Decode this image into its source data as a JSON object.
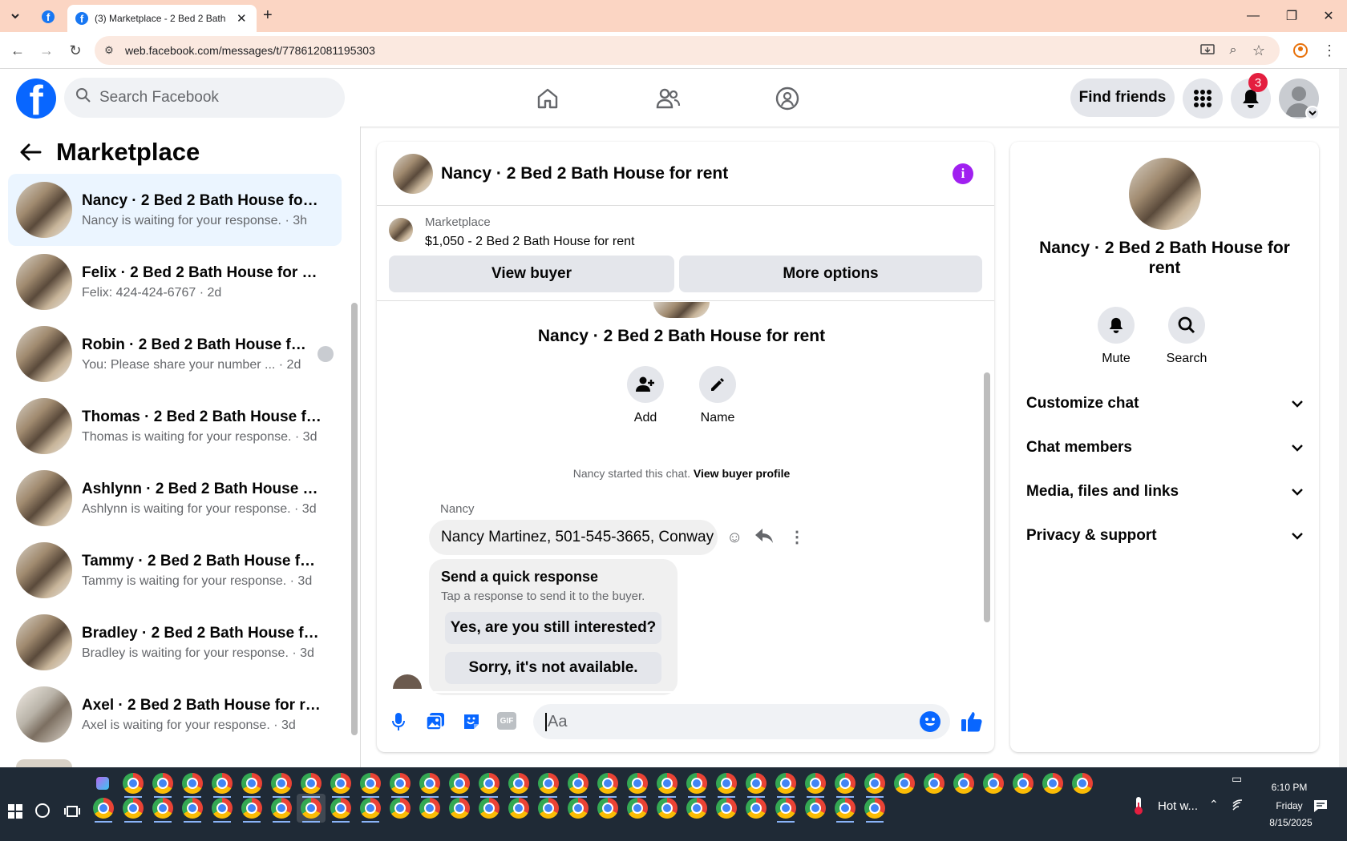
{
  "browser": {
    "tab_title": "(3) Marketplace - 2 Bed 2 Bath",
    "url": "web.facebook.com/messages/t/778612081195303"
  },
  "header": {
    "search_placeholder": "Search Facebook",
    "find_friends": "Find friends",
    "notification_count": "3"
  },
  "sidebar": {
    "title": "Marketplace",
    "conversations": [
      {
        "name": "Nancy · 2 Bed 2 Bath House for r...",
        "preview": "Nancy is waiting for your response.",
        "time": "3h"
      },
      {
        "name": "Felix · 2 Bed 2 Bath House for rent",
        "preview": "Felix: 424-424-6767",
        "time": "2d"
      },
      {
        "name": "Robin · 2 Bed 2 Bath House fo...",
        "preview": "You: Please share your number ...",
        "time": "2d"
      },
      {
        "name": "Thomas · 2 Bed 2 Bath House for...",
        "preview": "Thomas is waiting for your response.",
        "time": "3d"
      },
      {
        "name": "Ashlynn · 2 Bed 2 Bath House for...",
        "preview": "Ashlynn is waiting for your response.",
        "time": "3d"
      },
      {
        "name": "Tammy · 2 Bed 2 Bath House for ...",
        "preview": "Tammy is waiting for your response.",
        "time": "3d"
      },
      {
        "name": "Bradley · 2 Bed 2 Bath House for...",
        "preview": "Bradley is waiting for your response.",
        "time": "3d"
      },
      {
        "name": "Axel · 2 Bed 2 Bath House for rent",
        "preview": "Axel is waiting for your response.",
        "time": "3d"
      }
    ]
  },
  "chat": {
    "title": "Nancy · 2 Bed 2 Bath House for rent",
    "marketplace_label": "Marketplace",
    "listing": "$1,050 - 2 Bed 2 Bath House for rent",
    "view_buyer": "View buyer",
    "more_options": "More options",
    "thread_name": "Nancy · 2 Bed 2 Bath House for rent",
    "add_label": "Add",
    "name_label": "Name",
    "started_text": "Nancy started this chat.",
    "view_buyer_profile": "View buyer profile",
    "sender": "Nancy",
    "message": "Nancy Martinez, 501-545-3665, Conway",
    "quick_title": "Send a quick response",
    "quick_sub": "Tap a response to send it to the buyer.",
    "quick_1": "Yes, are you still interested?",
    "quick_2": "Sorry, it's not available.",
    "composer_placeholder": "Aa"
  },
  "info": {
    "name": "Nancy · 2 Bed 2 Bath House for rent",
    "mute": "Mute",
    "search": "Search",
    "sections": [
      "Customize chat",
      "Chat members",
      "Media, files and links",
      "Privacy & support"
    ]
  },
  "taskbar": {
    "weather": "Hot w...",
    "time": "6:10 PM",
    "day": "Friday",
    "date": "8/15/2025"
  },
  "colors": {
    "brand": "#0866ff",
    "accent": "#a020f0",
    "notification": "#e41e3f"
  }
}
